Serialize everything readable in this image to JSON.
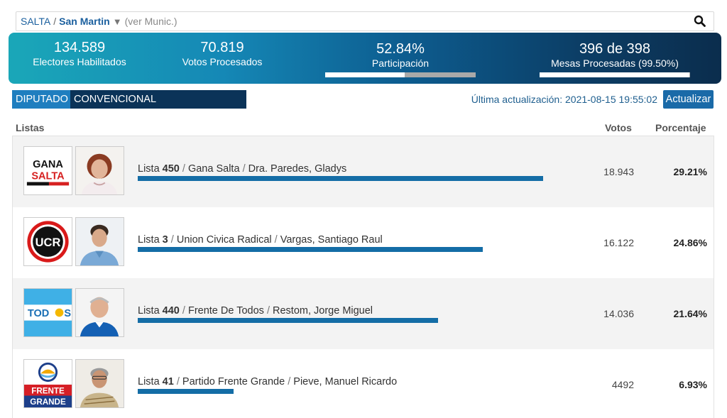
{
  "location": {
    "province": "SALTA",
    "separator": "/",
    "municipality": "San Martin",
    "dropdown_glyph": "▼",
    "see_municipalities": "(ver Munic.)",
    "search_icon": "search-icon"
  },
  "stats": {
    "electores": {
      "value": "134.589",
      "label": "Electores Habilitados"
    },
    "votos": {
      "value": "70.819",
      "label": "Votos Procesados"
    },
    "participacion": {
      "value": "52.84%",
      "label": "Participación",
      "progress": 0.5284
    },
    "mesas": {
      "value": "396 de 398",
      "label": "Mesas Procesadas (99.50%)",
      "progress": 0.995
    }
  },
  "tabs": [
    {
      "label": "DIPUTADO",
      "active": false
    },
    {
      "label": "CONVENCIONAL CONSTITUYENTE",
      "active": true
    }
  ],
  "last_update": "Última actualización: 2021-08-15 19:55:02",
  "update_button": "Actualizar",
  "table": {
    "headers": {
      "listas": "Listas",
      "votos": "Votos",
      "porcentaje": "Porcentaje"
    },
    "rows": [
      {
        "lista_prefix": "Lista",
        "lista_num": "450",
        "party": "Gana Salta",
        "candidate": "Dra. Paredes, Gladys",
        "votes": "18.943",
        "pct": "29.21%",
        "share": 0.2921,
        "logo_text": [
          "GANA",
          "SALTA"
        ],
        "logo_icon": "gana-salta-logo"
      },
      {
        "lista_prefix": "Lista",
        "lista_num": "3",
        "party": "Union Civica Radical",
        "candidate": "Vargas, Santiago Raul",
        "votes": "16.122",
        "pct": "24.86%",
        "share": 0.2486,
        "logo_text": [
          "UCR"
        ],
        "logo_icon": "ucr-logo"
      },
      {
        "lista_prefix": "Lista",
        "lista_num": "440",
        "party": "Frente De Todos",
        "candidate": "Restom, Jorge Miguel",
        "votes": "14.036",
        "pct": "21.64%",
        "share": 0.2164,
        "logo_text": [
          "TOD",
          "S"
        ],
        "logo_icon": "frente-de-todos-logo"
      },
      {
        "lista_prefix": "Lista",
        "lista_num": "41",
        "party": "Partido Frente Grande",
        "candidate": "Pieve, Manuel Ricardo",
        "votes": "4492",
        "pct": "6.93%",
        "share": 0.0693,
        "logo_text": [
          "FRENTE",
          "GRANDE"
        ],
        "logo_icon": "frente-grande-logo"
      }
    ]
  },
  "colors": {
    "accent_blue": "#146da6",
    "tab_active": "#0b3358",
    "tab_inactive": "#1f7ebf",
    "banner_start": "#1aa7b8",
    "banner_end": "#0b2d4d"
  }
}
